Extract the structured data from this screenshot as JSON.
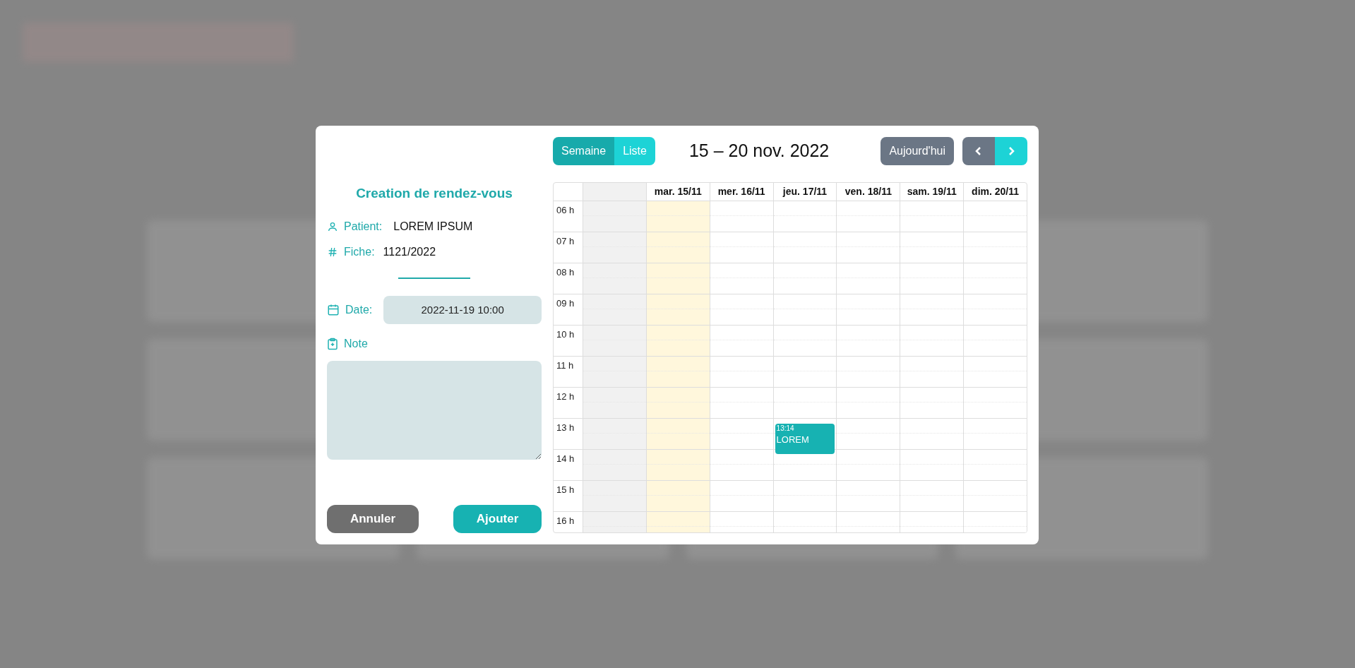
{
  "view_tabs": [
    {
      "label": "Semaine",
      "selected": true
    },
    {
      "label": "Liste",
      "selected": false
    }
  ],
  "range_title": "15 – 20 nov. 2022",
  "today_button": "Aujourd'hui",
  "form": {
    "title": "Creation de rendez-vous",
    "patient_label": "Patient:",
    "patient_value": "LOREM IPSUM",
    "fiche_label": "Fiche:",
    "fiche_value": "1121/2022",
    "date_label": "Date:",
    "date_value": "2022-11-19 10:00",
    "note_label": "Note"
  },
  "buttons": [
    {
      "label": "Annuler",
      "kind": "cancel"
    },
    {
      "label": "Ajouter",
      "kind": "primary"
    }
  ],
  "calendar": {
    "hours": [
      "06 h",
      "07 h",
      "08 h",
      "09 h",
      "10 h",
      "11 h",
      "12 h",
      "13 h",
      "14 h",
      "15 h",
      "16 h"
    ],
    "days": [
      {
        "kind": "disabled"
      },
      {
        "kind": "day",
        "label": "mar. 15/11",
        "today": true
      },
      {
        "kind": "day",
        "label": "mer. 16/11",
        "today": false
      },
      {
        "kind": "day",
        "label": "jeu. 17/11",
        "today": false,
        "events": [
          {
            "time": "13:14",
            "title": "LOREM"
          }
        ]
      },
      {
        "kind": "day",
        "label": "ven. 18/11",
        "today": false
      },
      {
        "kind": "day",
        "label": "sam. 19/11",
        "today": false
      },
      {
        "kind": "day",
        "label": "dim. 20/11",
        "today": false
      }
    ]
  }
}
